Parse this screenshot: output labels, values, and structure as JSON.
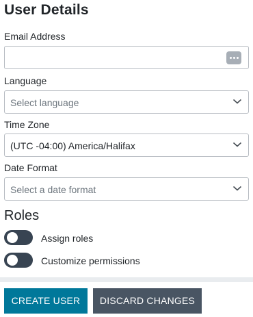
{
  "title": "User Details",
  "email": {
    "label": "Email Address",
    "value": "",
    "icon": "more-dots-icon"
  },
  "language": {
    "label": "Language",
    "placeholder": "Select language"
  },
  "timezone": {
    "label": "Time Zone",
    "value": "(UTC -04:00) America/Halifax"
  },
  "date_format": {
    "label": "Date Format",
    "placeholder": "Select a date format"
  },
  "roles": {
    "title": "Roles",
    "toggles": [
      {
        "label": "Assign roles",
        "on": false
      },
      {
        "label": "Customize permissions",
        "on": false
      }
    ]
  },
  "actions": {
    "create_label": "CREATE USER",
    "discard_label": "DISCARD CHANGES"
  },
  "colors": {
    "primary_button": "#00789a",
    "secondary_button": "#495563",
    "toggle_track": "#384452",
    "field_border": "#b7bcc2"
  }
}
